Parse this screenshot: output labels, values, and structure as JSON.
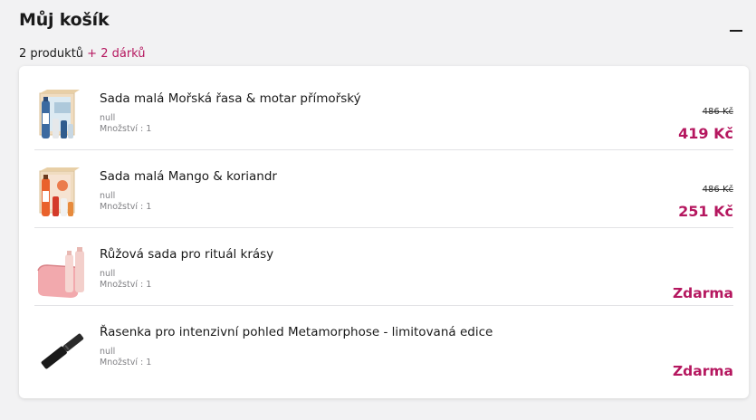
{
  "header": {
    "title": "Můj košík",
    "products_count": "2 produktů",
    "gifts_count": "+ 2 dárků"
  },
  "colors": {
    "accent": "#b5175f",
    "background": "#f2f2f3",
    "card": "#ffffff"
  },
  "items": [
    {
      "name": "Sada malá Mořská řasa & motar přímořský",
      "variant": "null",
      "quantity": "Množství : 1",
      "old_price": "486 Kč",
      "price": "419 Kč",
      "free_label": "",
      "thumbnail": "gift-box-sea-icon"
    },
    {
      "name": "Sada malá Mango & koriandr",
      "variant": "null",
      "quantity": "Množství : 1",
      "old_price": "486 Kč",
      "price": "251 Kč",
      "free_label": "",
      "thumbnail": "gift-box-mango-icon"
    },
    {
      "name": "Růžová sada pro rituál krásy",
      "variant": "null",
      "quantity": "Množství : 1",
      "old_price": "",
      "price": "",
      "free_label": "Zdarma",
      "thumbnail": "pink-pouch-icon"
    },
    {
      "name": "Řasenka pro intenzivní pohled Metamorphose - limitovaná edice",
      "variant": "null",
      "quantity": "Množství : 1",
      "old_price": "",
      "price": "",
      "free_label": "Zdarma",
      "thumbnail": "mascara-icon"
    }
  ]
}
